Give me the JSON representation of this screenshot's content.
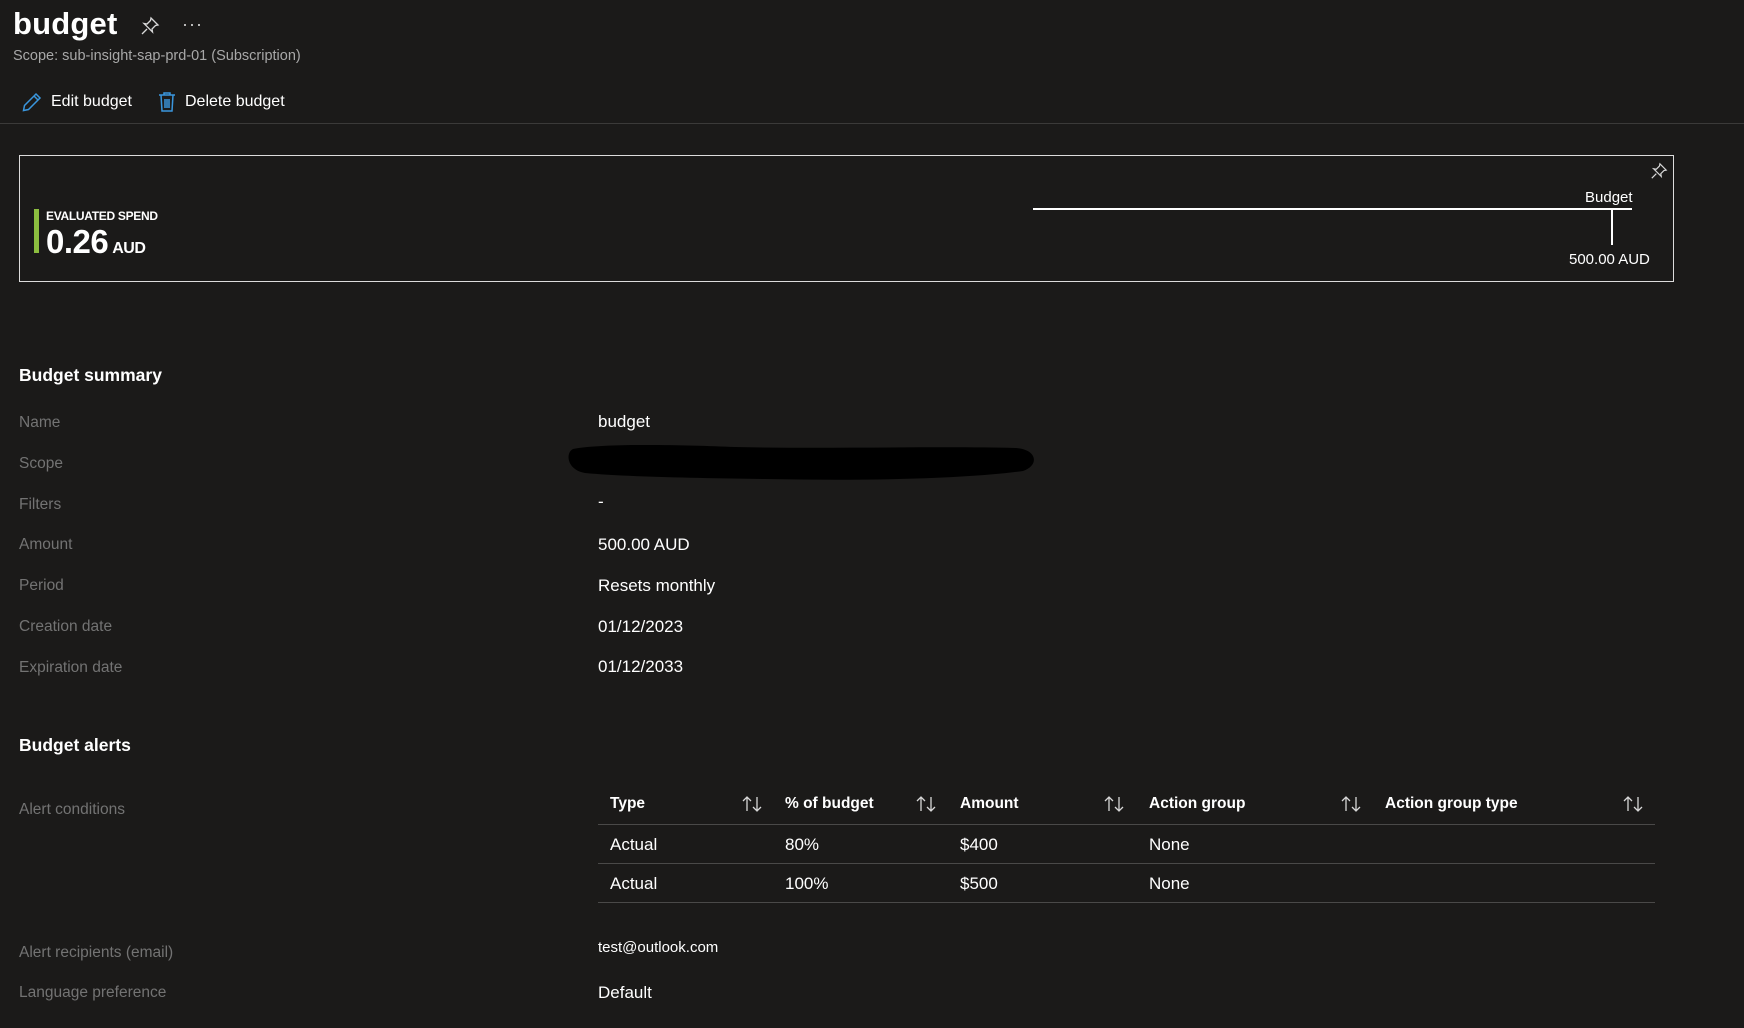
{
  "header": {
    "title": "budget",
    "more_label": "···",
    "subtitle": "Scope: sub-insight-sap-prd-01 (Subscription)"
  },
  "toolbar": {
    "edit_label": "Edit budget",
    "delete_label": "Delete budget"
  },
  "spend_card": {
    "spend_label": "EVALUATED SPEND",
    "spend_value": "0.26",
    "spend_unit": "AUD",
    "budget_label": "Budget",
    "budget_value": "500.00 AUD",
    "accent_color": "#8cbd3f"
  },
  "summary": {
    "heading": "Budget summary",
    "rows": [
      {
        "label": "Name",
        "value": "budget"
      },
      {
        "label": "Scope",
        "value": ""
      },
      {
        "label": "Filters",
        "value": "-"
      },
      {
        "label": "Amount",
        "value": "500.00 AUD"
      },
      {
        "label": "Period",
        "value": "Resets monthly"
      },
      {
        "label": "Creation date",
        "value": "01/12/2023"
      },
      {
        "label": "Expiration date",
        "value": "01/12/2033"
      }
    ]
  },
  "alerts": {
    "heading": "Budget alerts",
    "conditions_label": "Alert conditions",
    "columns": [
      "Type",
      "% of budget",
      "Amount",
      "Action group",
      "Action group type"
    ],
    "rows": [
      [
        "Actual",
        "80%",
        "$400",
        "None",
        ""
      ],
      [
        "Actual",
        "100%",
        "$500",
        "None",
        ""
      ]
    ],
    "recipients_label": "Alert recipients (email)",
    "recipients_value": "test@outlook.com",
    "language_label": "Language preference",
    "language_value": "Default"
  },
  "icons": {
    "pin": "pin-icon",
    "more": "more-icon",
    "edit": "pencil-icon",
    "delete": "trash-icon",
    "sort": "sort-icon"
  }
}
